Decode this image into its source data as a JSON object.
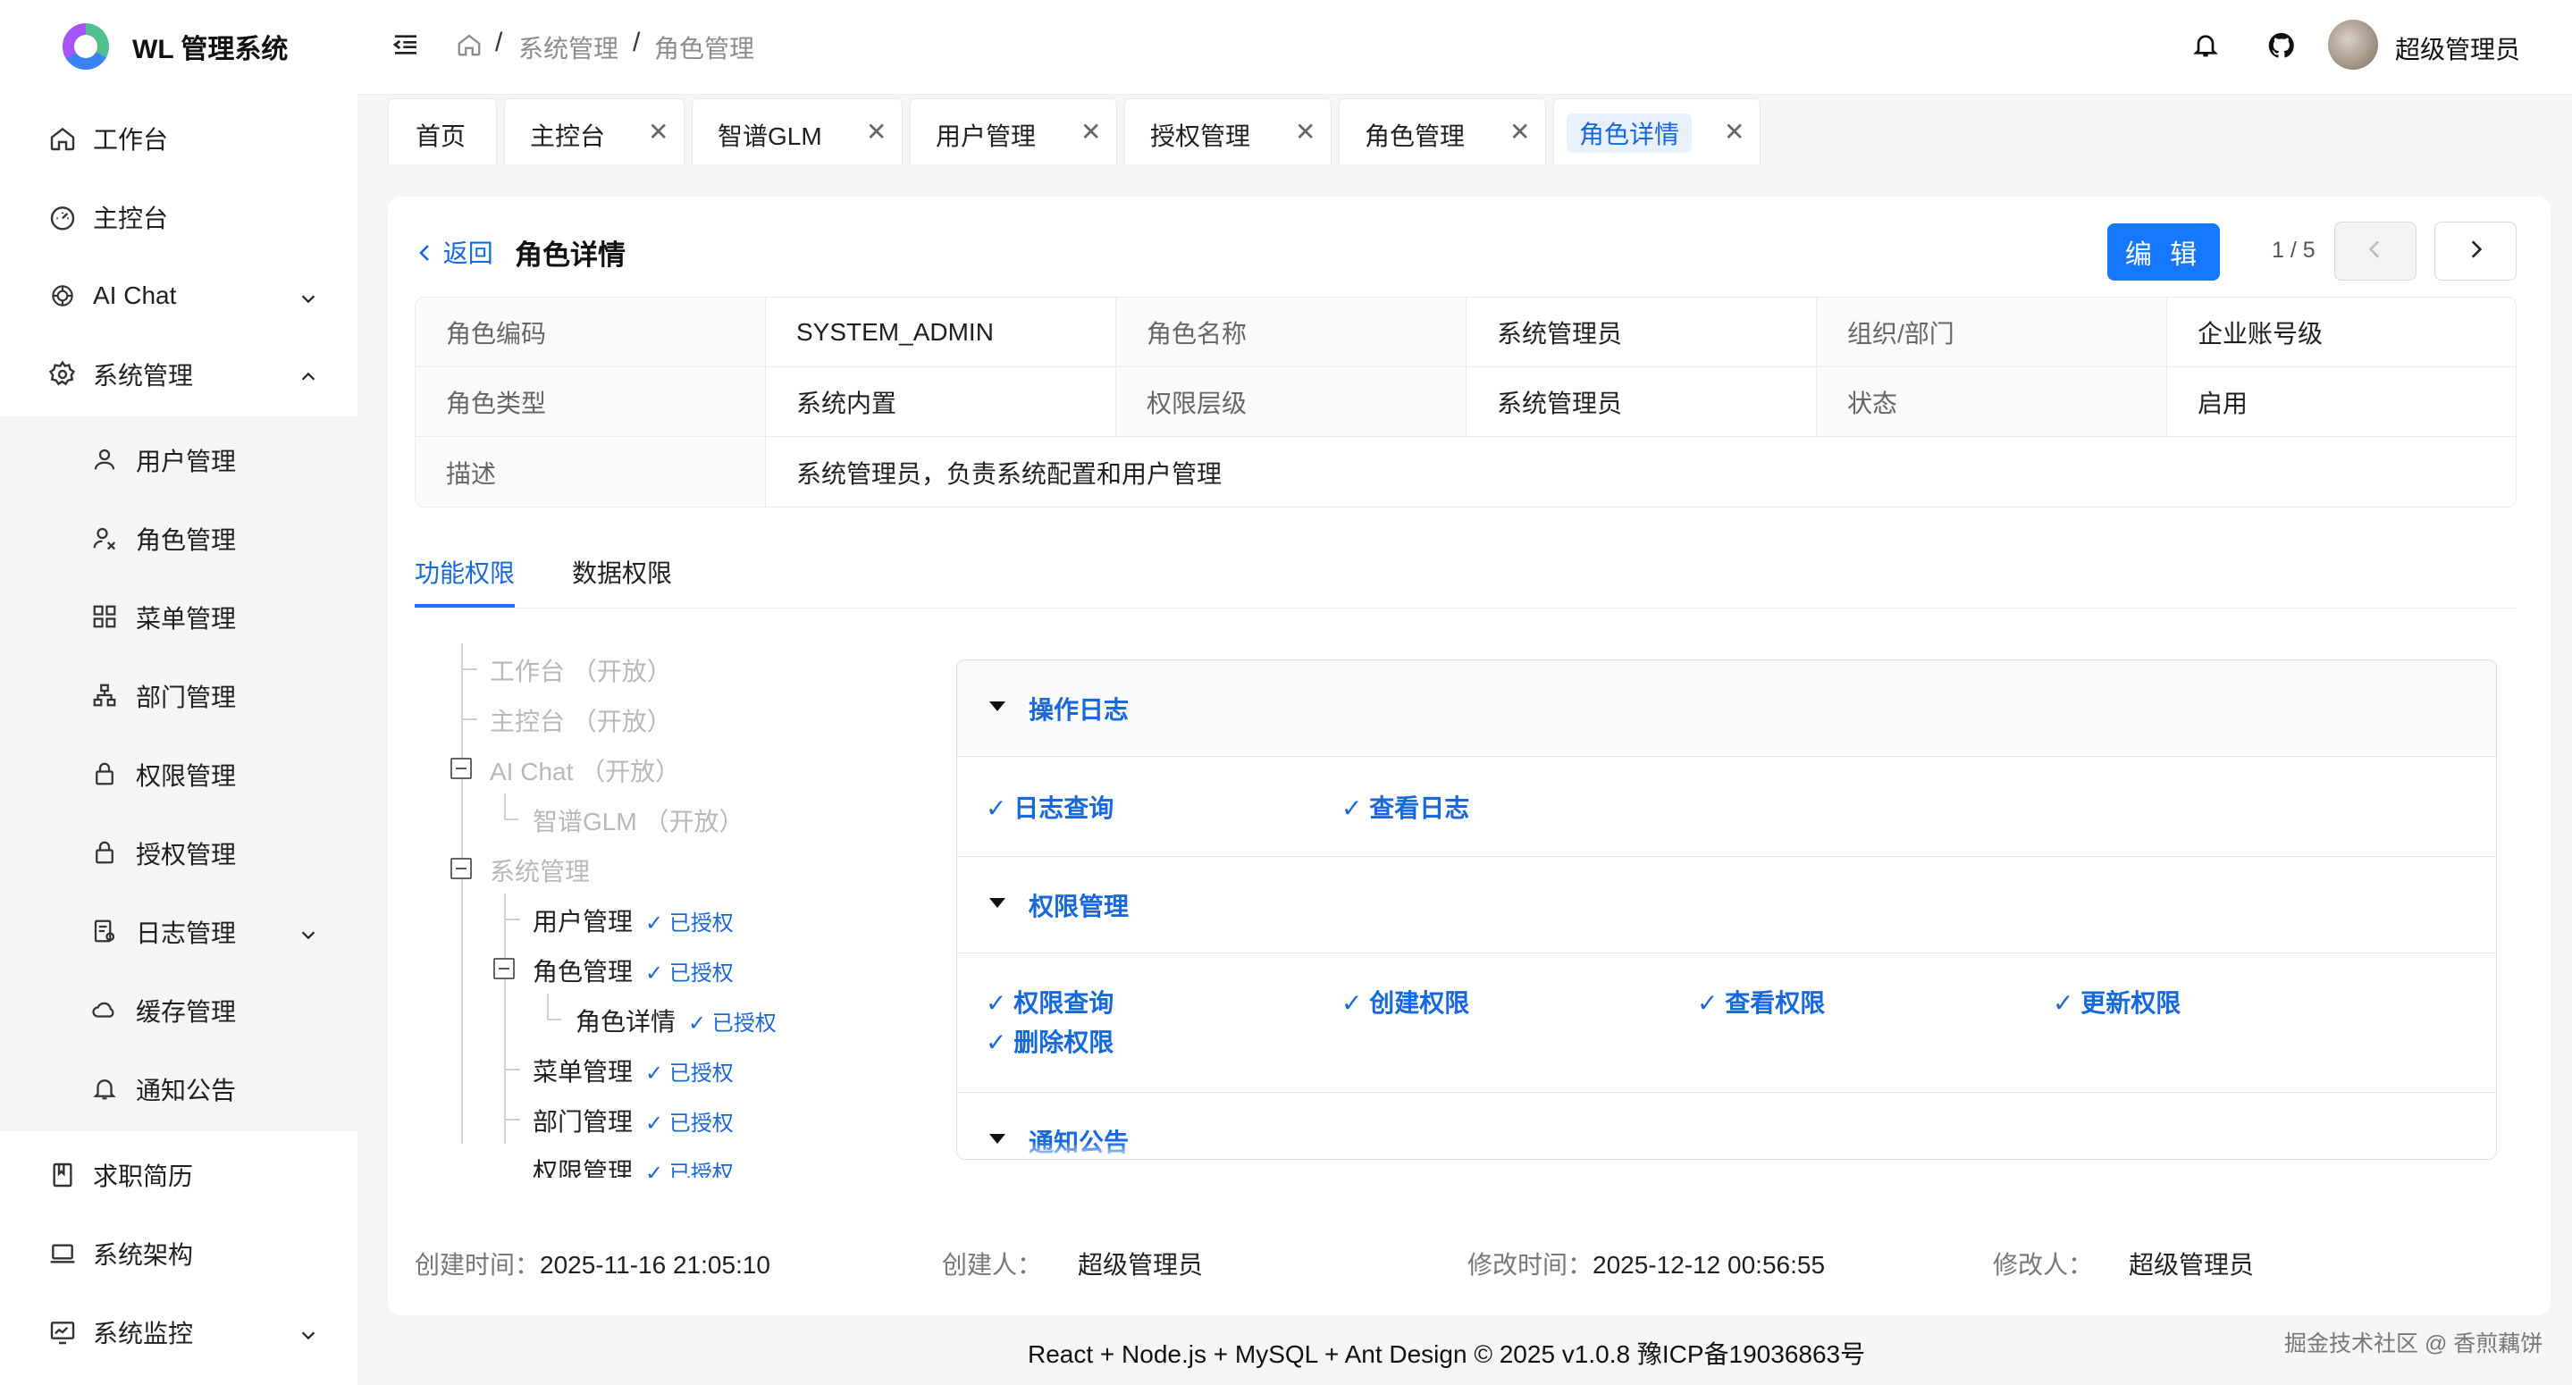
{
  "app": {
    "title": "WL 管理系统"
  },
  "sidebar": {
    "items": [
      {
        "label": "工作台",
        "icon": "home-icon"
      },
      {
        "label": "主控台",
        "icon": "dashboard-icon"
      },
      {
        "label": "AI Chat",
        "icon": "openai-icon"
      },
      {
        "label": "系统管理",
        "icon": "gear-icon"
      },
      {
        "label": "用户管理",
        "icon": "user-icon"
      },
      {
        "label": "角色管理",
        "icon": "role-icon"
      },
      {
        "label": "菜单管理",
        "icon": "menu-grid-icon"
      },
      {
        "label": "部门管理",
        "icon": "org-icon"
      },
      {
        "label": "权限管理",
        "icon": "lock-icon"
      },
      {
        "label": "授权管理",
        "icon": "lock-icon"
      },
      {
        "label": "日志管理",
        "icon": "log-icon"
      },
      {
        "label": "缓存管理",
        "icon": "cloud-icon"
      },
      {
        "label": "通知公告",
        "icon": "bell-icon"
      },
      {
        "label": "求职简历",
        "icon": "book-icon"
      },
      {
        "label": "系统架构",
        "icon": "laptop-icon"
      },
      {
        "label": "系统监控",
        "icon": "monitor-icon"
      }
    ]
  },
  "header": {
    "breadcrumb": [
      "系统管理",
      "角色管理"
    ],
    "user": "超级管理员"
  },
  "tabs": [
    {
      "label": "首页",
      "closable": false
    },
    {
      "label": "主控台",
      "closable": true
    },
    {
      "label": "智谱GLM",
      "closable": true
    },
    {
      "label": "用户管理",
      "closable": true
    },
    {
      "label": "授权管理",
      "closable": true
    },
    {
      "label": "角色管理",
      "closable": true
    },
    {
      "label": "角色详情",
      "closable": true,
      "active": true
    }
  ],
  "detail": {
    "back": "返回",
    "title": "角色详情",
    "edit": "编 辑",
    "pager": "1 / 5",
    "fields": {
      "code_k": "角色编码",
      "code_v": "SYSTEM_ADMIN",
      "name_k": "角色名称",
      "name_v": "系统管理员",
      "org_k": "组织/部门",
      "org_v": "企业账号级",
      "type_k": "角色类型",
      "type_v": "系统内置",
      "level_k": "权限层级",
      "level_v": "系统管理员",
      "status_k": "状态",
      "status_v": "启用",
      "desc_k": "描述",
      "desc_v": "系统管理员，负责系统配置和用户管理"
    },
    "subtabs": [
      "功能权限",
      "数据权限"
    ]
  },
  "tree": {
    "authorized": "✓ 已授权",
    "nodes": [
      "工作台 （开放）",
      "主控台 （开放）",
      "AI Chat （开放）",
      "智谱GLM （开放）",
      "系统管理",
      "用户管理",
      "角色管理",
      "角色详情",
      "菜单管理",
      "部门管理",
      "权限管理"
    ]
  },
  "permissions": {
    "groups": [
      {
        "title": "操作日志",
        "items": [
          "✓ 日志查询",
          "✓ 查看日志"
        ]
      },
      {
        "title": "权限管理",
        "items": [
          "✓ 权限查询",
          "✓ 创建权限",
          "✓ 查看权限",
          "✓ 更新权限",
          "✓ 删除权限"
        ]
      },
      {
        "title": "通知公告",
        "items": []
      }
    ]
  },
  "meta": {
    "created_k": "创建时间：",
    "created_v": "2025-11-16 21:05:10",
    "creator_k": "创建人：",
    "creator_v": "超级管理员",
    "modified_k": "修改时间：",
    "modified_v": "2025-12-12 00:56:55",
    "modifier_k": "修改人：",
    "modifier_v": "超级管理员"
  },
  "footer": "React + Node.js + MySQL + Ant Design © 2025 v1.0.8   豫ICP备19036863号",
  "watermark": "掘金技术社区 @ 香煎藕饼",
  "colors": {
    "accent": "#1677ff",
    "link": "#1668dc"
  }
}
